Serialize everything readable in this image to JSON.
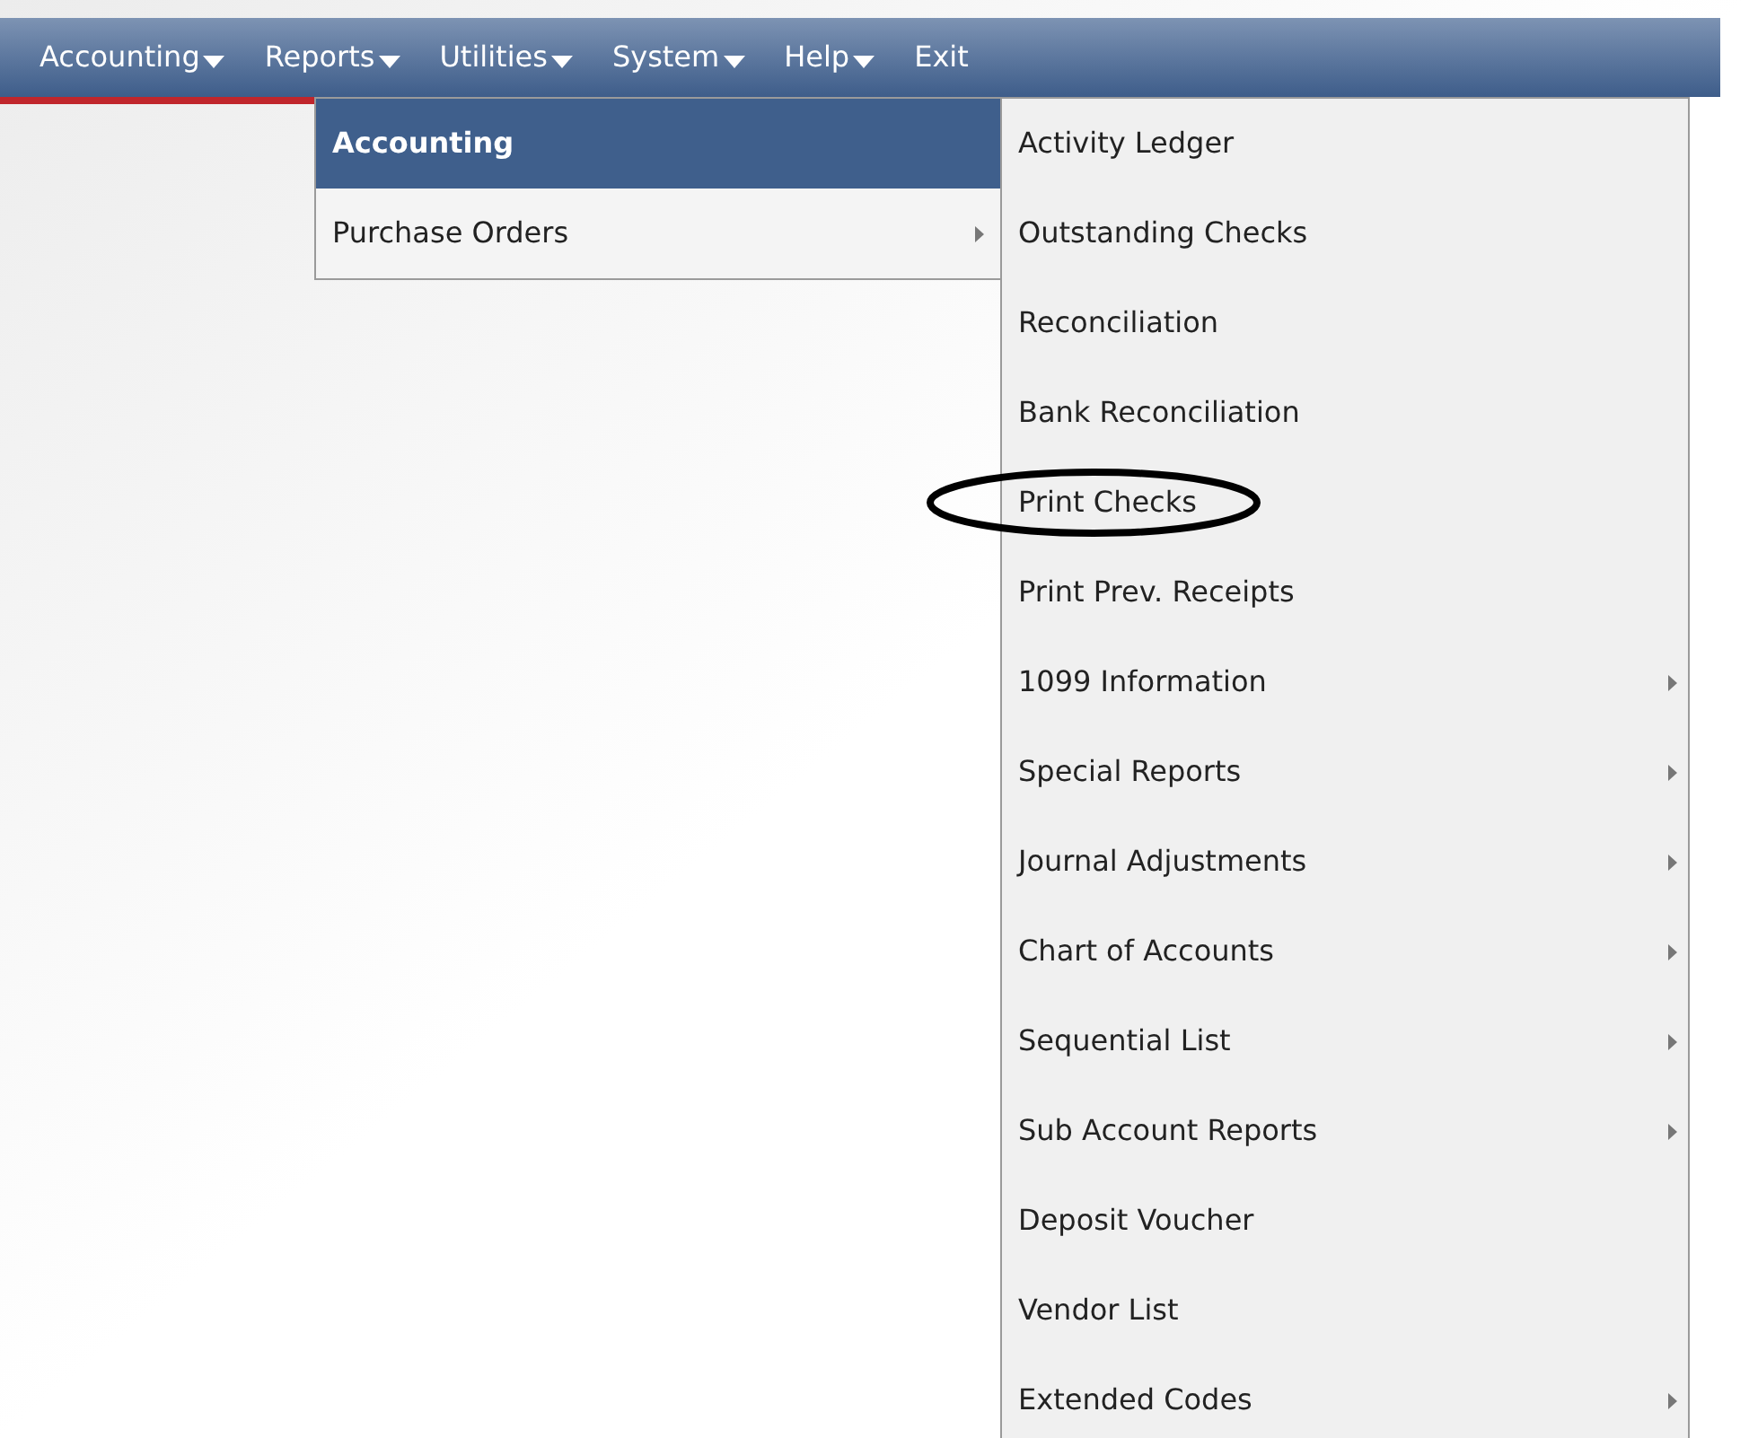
{
  "menu_bar": [
    {
      "label": "Accounting",
      "dropdown": true
    },
    {
      "label": "Reports",
      "dropdown": true
    },
    {
      "label": "Utilities",
      "dropdown": true
    },
    {
      "label": "System",
      "dropdown": true
    },
    {
      "label": "Help",
      "dropdown": true
    },
    {
      "label": "Exit",
      "dropdown": false
    }
  ],
  "reports_menu": [
    {
      "label": "Accounting",
      "submenu": false,
      "selected": true
    },
    {
      "label": "Purchase Orders",
      "submenu": true,
      "selected": false
    }
  ],
  "accounting_menu": [
    {
      "label": "Activity Ledger",
      "submenu": false,
      "circled": false
    },
    {
      "label": "Outstanding Checks",
      "submenu": false,
      "circled": false
    },
    {
      "label": "Reconciliation",
      "submenu": false,
      "circled": false
    },
    {
      "label": "Bank Reconciliation",
      "submenu": false,
      "circled": false
    },
    {
      "label": "Print Checks",
      "submenu": false,
      "circled": true
    },
    {
      "label": "Print Prev. Receipts",
      "submenu": false,
      "circled": false
    },
    {
      "label": "1099 Information",
      "submenu": true,
      "circled": false
    },
    {
      "label": "Special Reports",
      "submenu": true,
      "circled": false
    },
    {
      "label": "Journal Adjustments",
      "submenu": true,
      "circled": false
    },
    {
      "label": "Chart of Accounts",
      "submenu": true,
      "circled": false
    },
    {
      "label": "Sequential List",
      "submenu": true,
      "circled": false
    },
    {
      "label": "Sub Account Reports",
      "submenu": true,
      "circled": false
    },
    {
      "label": "Deposit Voucher",
      "submenu": false,
      "circled": false
    },
    {
      "label": "Vendor List",
      "submenu": false,
      "circled": false
    },
    {
      "label": "Extended Codes",
      "submenu": true,
      "circled": false
    }
  ]
}
